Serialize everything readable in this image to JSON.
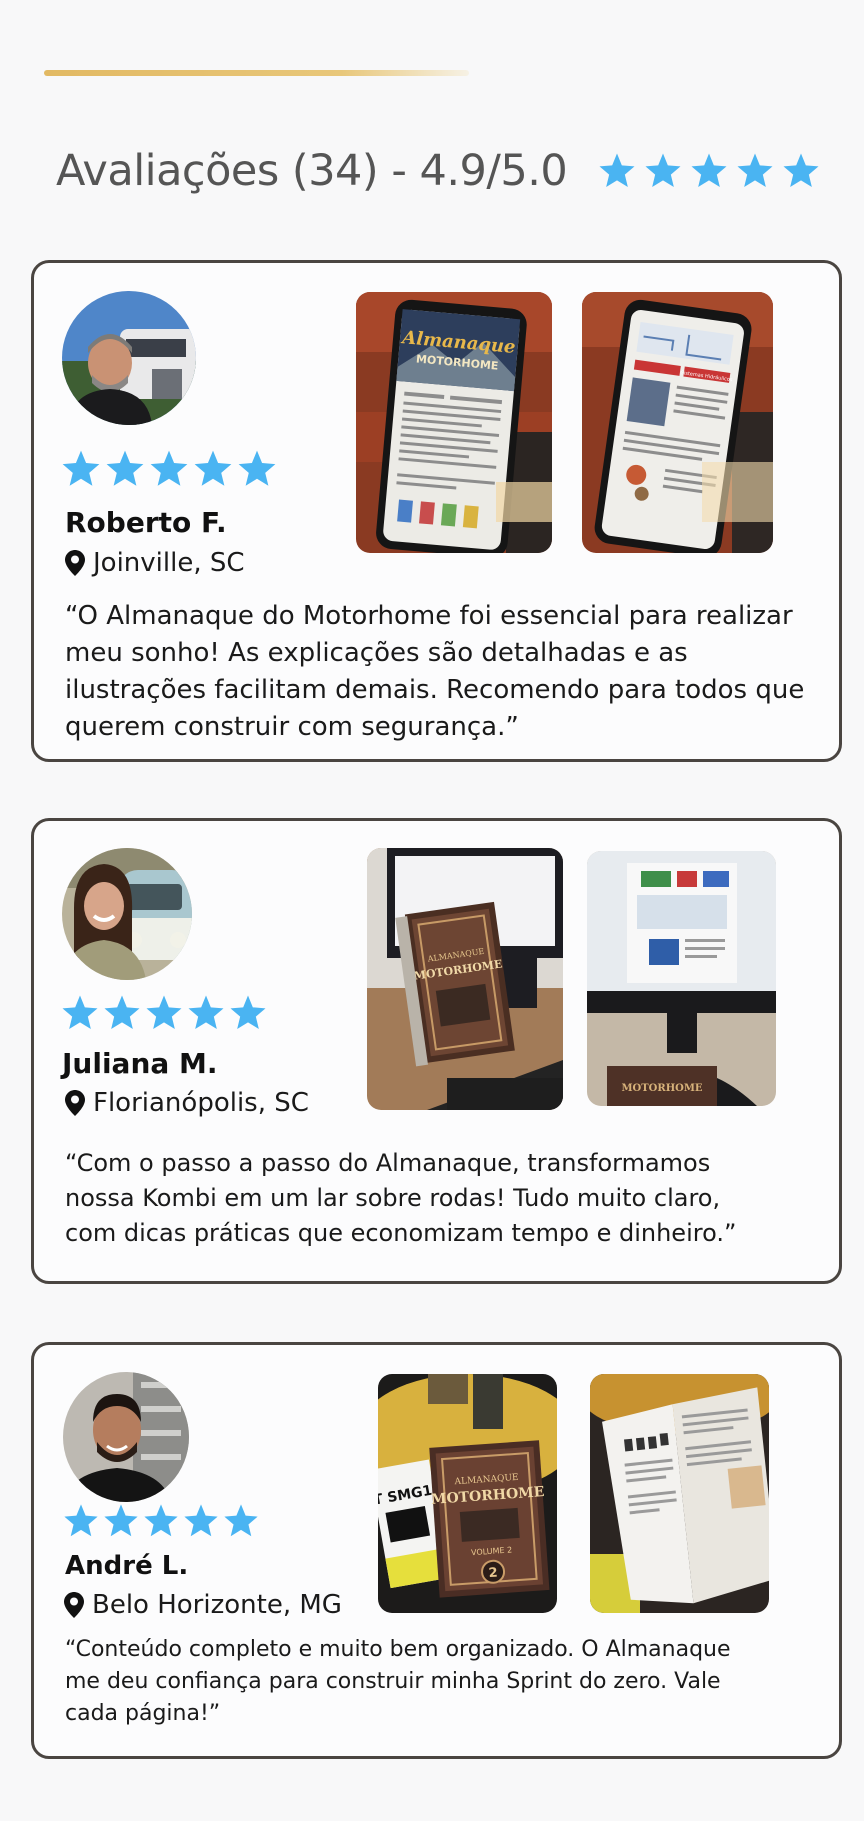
{
  "header": {
    "title": "Avaliações (34) - 4.9/5.0",
    "rating_value": 4.9,
    "rating_max": 5.0,
    "star_count": 5
  },
  "colors": {
    "star": "#4ab4f2",
    "accent_line": "#e2b963",
    "card_border": "#4a4541",
    "heading": "#555555"
  },
  "reviews": [
    {
      "name": "Roberto F.",
      "location": "Joinville, SC",
      "stars": 5,
      "quote": "“O Almanaque do Motorhome foi essencial para realizar meu sonho! As explicações são detalhadas e as ilustrações facilitam demais. Recomendo para todos que querem construir com segurança.”",
      "photo_1": {
        "title": "Almanaque",
        "subtitle": "MOTORHOME"
      },
      "photo_2": {
        "title": "Sistemas Hidráulicos"
      }
    },
    {
      "name": "Juliana M.",
      "location": "Florianópolis, SC",
      "stars": 5,
      "quote": "“Com o passo a passo do Almanaque, transformamos nossa Kombi em um lar sobre rodas! Tudo muito claro, com dicas práticas que economizam tempo e dinheiro.”",
      "photo_1": {
        "title": "ALMANAQUE",
        "subtitle": "MOTORHOME"
      },
      "photo_2": {
        "title": "MOTORHOME"
      }
    },
    {
      "name": "André L.",
      "location": "Belo Horizonte, MG",
      "stars": 5,
      "quote": "“Conteúdo completo e muito bem organizado. O Almanaque me deu confiança para construir minha Sprint do zero. Vale cada página!”",
      "photo_1": {
        "title": "ALMANAQUE",
        "subtitle": "MOTORHOME",
        "volume": "VOLUME 2",
        "number": "2",
        "label": "T SMG1"
      }
    }
  ]
}
